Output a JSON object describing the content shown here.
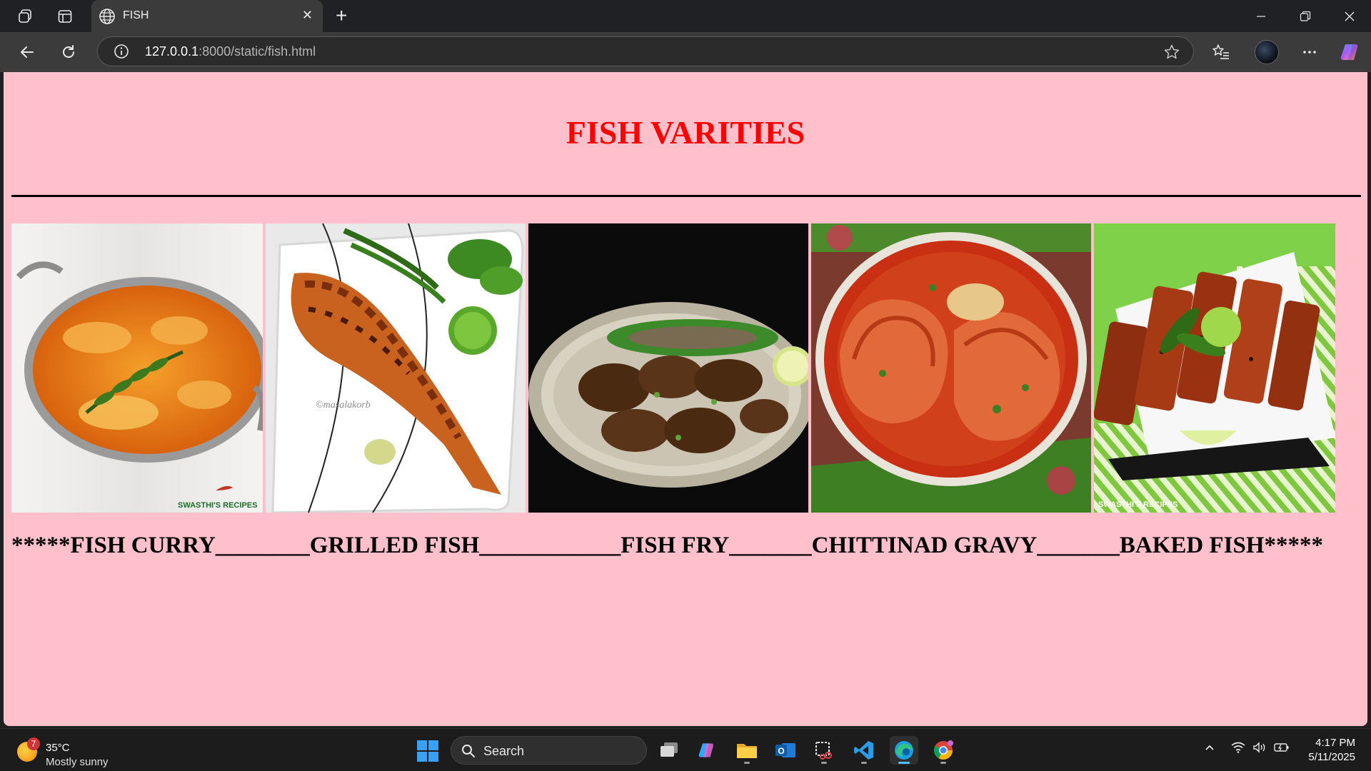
{
  "browser": {
    "tab_title": "FISH",
    "url_host": "127.0.0.1",
    "url_path": ":8000/static/fish.html"
  },
  "page": {
    "title": "FISH VARITIES",
    "images": [
      {
        "name": "fish-curry-image",
        "watermark": "SWASTHI'S RECIPES"
      },
      {
        "name": "grilled-fish-image",
        "watermark": "©masalakorb"
      },
      {
        "name": "fish-fry-image",
        "watermark": ""
      },
      {
        "name": "chittinad-gravy-image",
        "watermark": ""
      },
      {
        "name": "baked-fish-image",
        "watermark": "SWASTHI'S RECIPES"
      }
    ],
    "captions": "*****FISH CURRY________GRILLED FISH____________FISH FRY_______CHITTINAD GRAVY_______BAKED FISH*****"
  },
  "taskbar": {
    "weather_temp": "35°C",
    "weather_condition": "Mostly sunny",
    "weather_badge": "7",
    "search_label": "Search",
    "time": "4:17 PM",
    "date": "5/11/2025"
  }
}
